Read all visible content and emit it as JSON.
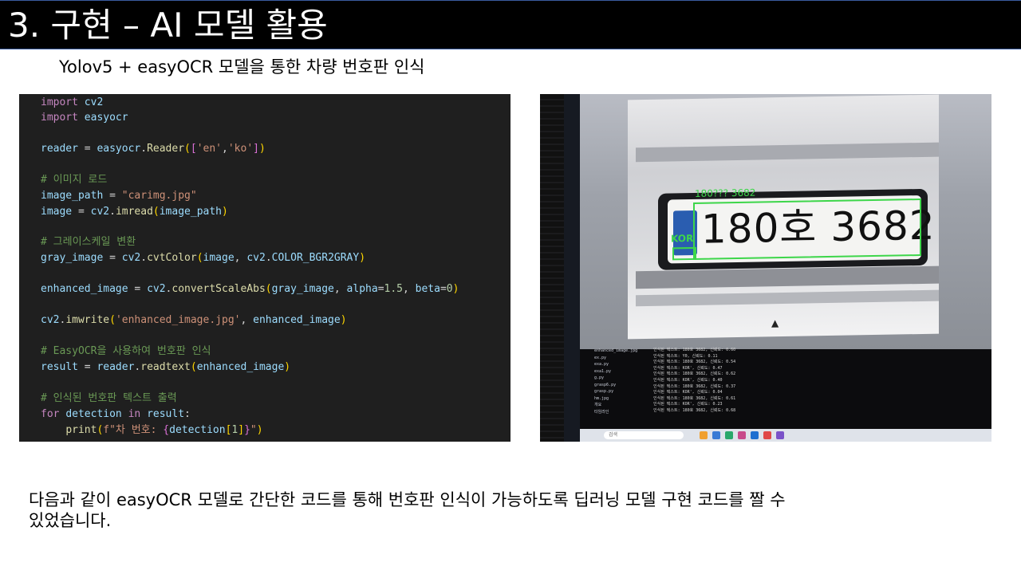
{
  "slide": {
    "title": "3. 구현 – AI 모델 활용",
    "subtitle": "Yolov5 + easyOCR 모델을 통한 차량 번호판 인식",
    "body_line1": "다음과 같이 easyOCR 모델로 간단한 코드를 통해 번호판 인식이 가능하도록 딥러닝 모델 구현 코드를 짤 수",
    "body_line2": "있었습니다."
  },
  "code": {
    "lines": [
      "import cv2",
      "import easyocr",
      "",
      "reader = easyocr.Reader(['en','ko'])",
      "",
      "# 이미지 로드",
      "image_path = \"carimg.jpg\"",
      "image = cv2.imread(image_path)",
      "",
      "# 그레이스케일 변환",
      "gray_image = cv2.cvtColor(image, cv2.COLOR_BGR2GRAY)",
      "",
      "enhanced_image = cv2.convertScaleAbs(gray_image, alpha=1.5, beta=0)",
      "",
      "cv2.imwrite('enhanced_image.jpg', enhanced_image)",
      "",
      "# EasyOCR을 사용하여 번호판 인식",
      "result = reader.readtext(enhanced_image)",
      "",
      "# 인식된 번호판 텍스트 출력",
      "for detection in result:",
      "    print(f\"차 번호: {detection[1]}\")"
    ]
  },
  "photo": {
    "plate_text": "180호 3682",
    "detected_label": "180??? 3682",
    "kor_label": "KOR",
    "explorer_items": [
      "enhanced_image.jpg",
      "ex.py",
      "exa.py",
      "exa1.py",
      "g.py",
      "grasp6.py",
      "grasp.py",
      "hm.jpg",
      "개요",
      "타임라인"
    ],
    "terminal_lines": [
      "인식된 텍스트: 180호 3682, 신뢰도: 0.60",
      "인식된 텍스트: Y0, 신뢰도: 0.11",
      "인식된 텍스트: 180호 3682, 신뢰도: 0.54",
      "인식된 텍스트: KOR', 신뢰도: 0.47",
      "인식된 텍스트: 180호 3682, 신뢰도: 0.62",
      "인식된 텍스트: KOR', 신뢰도: 0.40",
      "인식된 텍스트: 180호 3682, 신뢰도: 0.37",
      "인식된 텍스트: KOR', 신뢰도: 0.04",
      "인식된 텍스트: 180호 3682, 신뢰도: 0.61",
      "인식된 텍스트: KOR', 신뢰도: 0.23",
      "인식된 텍스트: 180호 3682, 신뢰도: 0.68"
    ],
    "taskbar_search": "검색"
  }
}
